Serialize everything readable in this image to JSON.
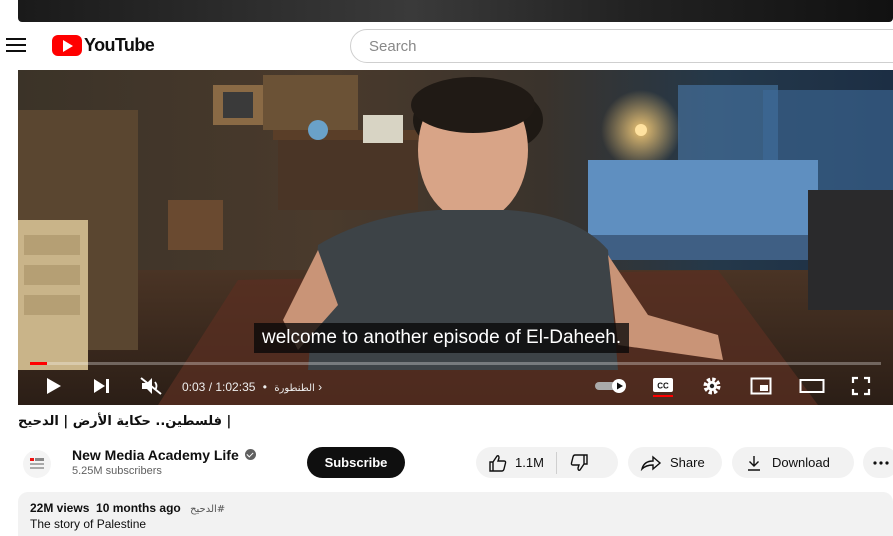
{
  "header": {
    "logo_text": "YouTube",
    "search_placeholder": "Search"
  },
  "player": {
    "caption": "welcome to another episode of El-Daheeh.",
    "current_time": "0:03",
    "duration": "1:02:35",
    "chapter": "الطنطورة",
    "progress_fraction": 0.001
  },
  "video": {
    "title": "| فلسطين.. حكاية الأرض | الدحيح"
  },
  "channel": {
    "name": "New Media Academy Life",
    "subscribers": "5.25M subscribers",
    "subscribe_label": "Subscribe"
  },
  "actions": {
    "likes": "1.1M",
    "share_label": "Share",
    "download_label": "Download"
  },
  "description": {
    "views": "22M views",
    "age": "10 months ago",
    "hashtag": "#الدحيح",
    "text": "The story of Palestine"
  },
  "colors": {
    "brand_red": "#ff0000",
    "subscribe_bg": "#0f0f0f",
    "pill_bg": "#f2f2f2"
  }
}
